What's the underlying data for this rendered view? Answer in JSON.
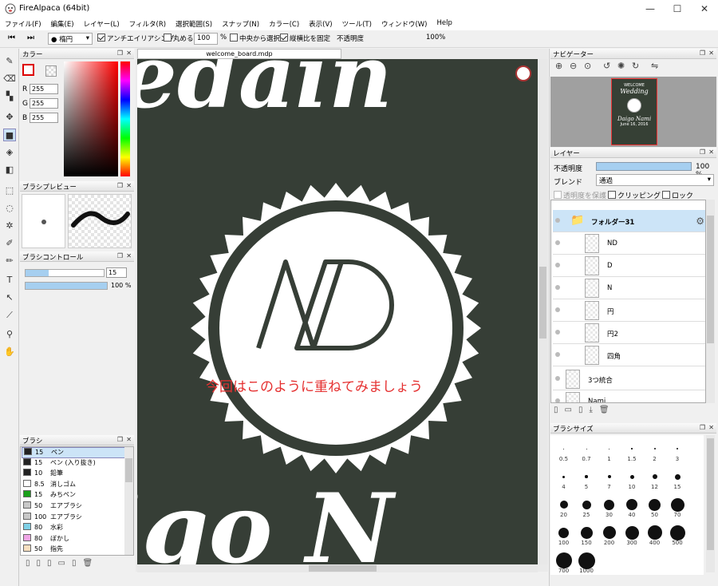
{
  "window": {
    "title": "FireAlpaca (64bit)",
    "minimize": "—",
    "maximize": "☐",
    "close": "✕"
  },
  "menu": [
    "ファイル(F)",
    "編集(E)",
    "レイヤー(L)",
    "フィルタ(R)",
    "選択範囲(S)",
    "スナップ(N)",
    "カラー(C)",
    "表示(V)",
    "ツール(T)",
    "ウィンドウ(W)",
    "Help"
  ],
  "toolbar": {
    "brush_shape": "楕円",
    "antialias": "アンチエイリアシング",
    "round": "丸める",
    "zoom_value": "100",
    "zoom_unit": "%",
    "center_select": "中央から選択",
    "aspect_fix": "縦横比を固定",
    "opacity_label": "不透明度",
    "opacity_value": "100%"
  },
  "color_panel": {
    "title": "カラー",
    "r_label": "R",
    "g_label": "G",
    "b_label": "B",
    "r": "255",
    "g": "255",
    "b": "255"
  },
  "brush_preview": {
    "title": "ブラシプレビュー"
  },
  "brush_control": {
    "title": "ブラシコントロール",
    "size": "15",
    "opacity": "100 %"
  },
  "brush_panel": {
    "title": "ブラシ",
    "items": [
      {
        "size": "15",
        "name": "ペン",
        "color": "#222222"
      },
      {
        "size": "15",
        "name": "ペン (入り抜き)",
        "color": "#222222"
      },
      {
        "size": "10",
        "name": "鉛筆",
        "color": "#222222"
      },
      {
        "size": "8.5",
        "name": "消しゴム",
        "color": "#ffffff"
      },
      {
        "size": "15",
        "name": "みちペン",
        "color": "#1aa01a"
      },
      {
        "size": "50",
        "name": "エアブラシ",
        "color": "#c8c8c8"
      },
      {
        "size": "100",
        "name": "エアブラシ",
        "color": "#c8c8c8"
      },
      {
        "size": "80",
        "name": "水彩",
        "color": "#7fd0e6"
      },
      {
        "size": "80",
        "name": "ぼかし",
        "color": "#f0a6e6"
      },
      {
        "size": "50",
        "name": "指先",
        "color": "#f8e0c0"
      }
    ]
  },
  "document": {
    "tab": "welcome_board.mdp",
    "overlay_text": "今回はこのように重ねてみましょう",
    "logo_text": "ND"
  },
  "navigator": {
    "title": "ナビゲーター",
    "thumb_line1": "WELCOME",
    "thumb_line2": "Wedding",
    "thumb_line3": "Daigo Nami",
    "thumb_line4": "June 16, 2016"
  },
  "layers_panel": {
    "title": "レイヤー",
    "opacity_label": "不透明度",
    "opacity_value": "100 %",
    "blend_label": "ブレンド",
    "blend_value": "通過",
    "protect": "透明度を保護",
    "clipping": "クリッピング",
    "lock": "ロック",
    "layers": [
      {
        "name": "フォルダー31",
        "type": "folder"
      },
      {
        "name": "ND",
        "type": "layer"
      },
      {
        "name": "D",
        "type": "layer"
      },
      {
        "name": "N",
        "type": "layer"
      },
      {
        "name": "円",
        "type": "layer"
      },
      {
        "name": "円2",
        "type": "layer"
      },
      {
        "name": "四角",
        "type": "layer"
      },
      {
        "name": "3つ統合",
        "type": "layer"
      },
      {
        "name": "Nami",
        "type": "layer"
      }
    ]
  },
  "brush_size_panel": {
    "title": "ブラシサイズ",
    "sizes": [
      "0.5",
      "0.7",
      "1",
      "1.5",
      "2",
      "3",
      "4",
      "5",
      "7",
      "10",
      "12",
      "15",
      "20",
      "25",
      "30",
      "40",
      "50",
      "70",
      "100",
      "150",
      "200",
      "300",
      "400",
      "500",
      "700",
      "1000"
    ]
  }
}
